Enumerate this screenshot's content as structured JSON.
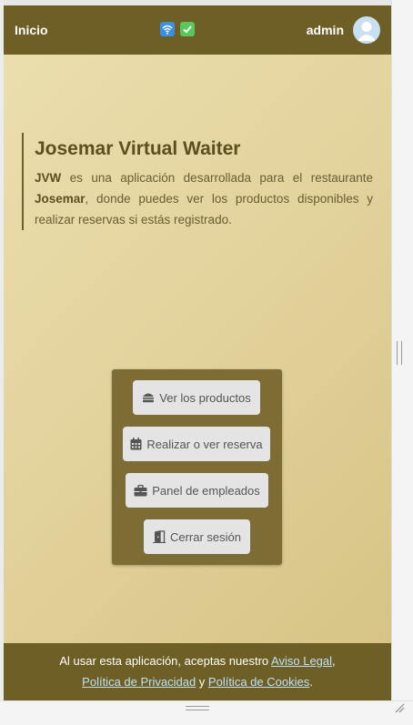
{
  "navbar": {
    "brand": "Inicio",
    "username": "admin",
    "status_icons": [
      "wifi-icon",
      "check-icon"
    ],
    "background_color": "#6e5f27"
  },
  "intro": {
    "title": "Josemar Virtual Waiter",
    "text_bold_1": "JVW",
    "text_1": " es una aplicación desarrollada para el restaurante ",
    "text_bold_2": "Josemar",
    "text_2": ", donde puedes ver los productos disponibles y realizar reservas si estás registrado."
  },
  "menu": {
    "buttons": [
      {
        "label": "Ver los productos",
        "icon": "burger-icon"
      },
      {
        "label": "Realizar o ver reserva",
        "icon": "calendar-icon"
      },
      {
        "label": "Panel de empleados",
        "icon": "briefcase-icon"
      },
      {
        "label": "Cerrar sesión",
        "icon": "door-exit-icon"
      }
    ]
  },
  "footer": {
    "text_1": "Al usar esta aplicación, aceptas nuestro ",
    "link_legal": "Aviso Legal",
    "sep_1": ",",
    "link_privacy": "Política de Privacidad",
    "sep_2": " y ",
    "link_cookies": "Política de Cookies",
    "end": "."
  },
  "colors": {
    "accent": "#6e5f27",
    "menu_panel": "#7d6c33",
    "link": "#bfe1f5",
    "gradient_start": "#ece0b0",
    "gradient_end": "#d5c283"
  }
}
